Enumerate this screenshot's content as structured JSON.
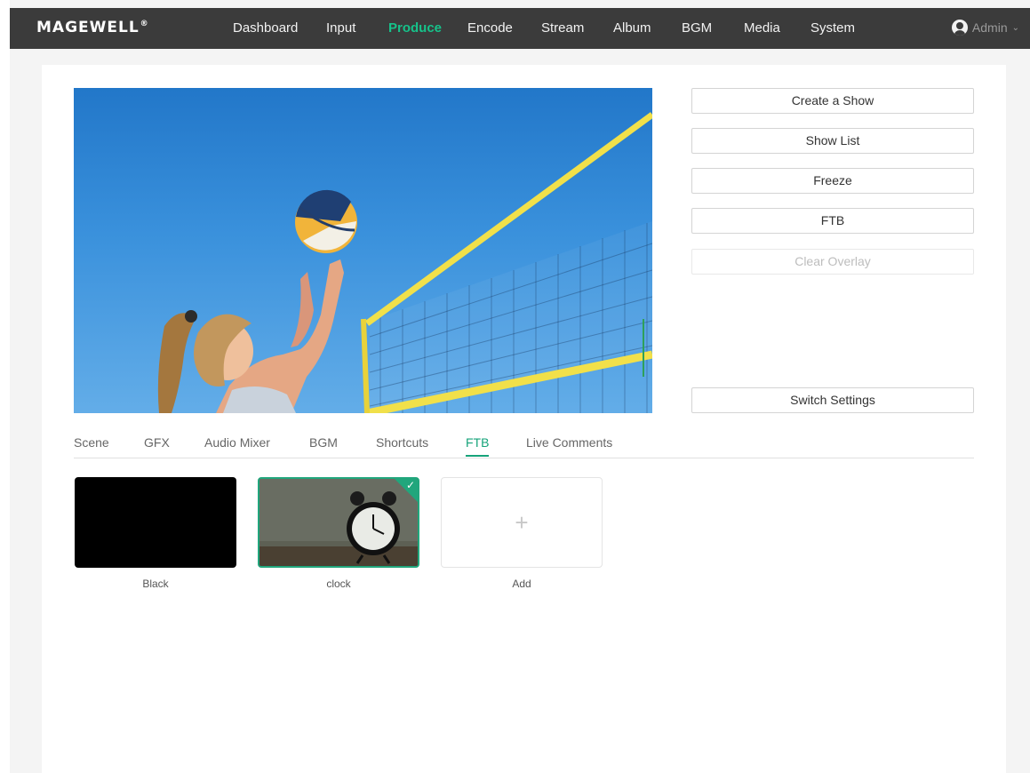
{
  "brand": {
    "name": "MAGEWELL",
    "mark": "®"
  },
  "nav": {
    "items": [
      {
        "label": "Dashboard",
        "active": false
      },
      {
        "label": "Input",
        "active": false
      },
      {
        "label": "Produce",
        "active": true
      },
      {
        "label": "Encode",
        "active": false
      },
      {
        "label": "Stream",
        "active": false
      },
      {
        "label": "Album",
        "active": false
      },
      {
        "label": "BGM",
        "active": false
      },
      {
        "label": "Media",
        "active": false
      },
      {
        "label": "System",
        "active": false
      }
    ],
    "user": {
      "label": "Admin",
      "icon": "user-avatar-icon",
      "chevron": "chevron-down-icon"
    }
  },
  "side_buttons": {
    "create_show": "Create a Show",
    "show_list": "Show List",
    "freeze": "Freeze",
    "ftb": "FTB",
    "clear_overlay": "Clear Overlay",
    "switch_settings": "Switch Settings"
  },
  "tabs": [
    {
      "label": "Scene",
      "active": false
    },
    {
      "label": "GFX",
      "active": false
    },
    {
      "label": "Audio Mixer",
      "active": false
    },
    {
      "label": "BGM",
      "active": false
    },
    {
      "label": "Shortcuts",
      "active": false
    },
    {
      "label": "FTB",
      "active": true
    },
    {
      "label": "Live Comments",
      "active": false
    }
  ],
  "ftb_items": [
    {
      "label": "Black",
      "selected": false
    },
    {
      "label": "clock",
      "selected": true
    },
    {
      "label": "Add",
      "selected": false
    }
  ],
  "colors": {
    "accent": "#16c28a",
    "active_tab": "#16a37a",
    "topbar": "#3b3b3b",
    "selected_border": "#21a67c"
  },
  "icons": {
    "add": "plus-icon",
    "selected": "check-icon"
  }
}
